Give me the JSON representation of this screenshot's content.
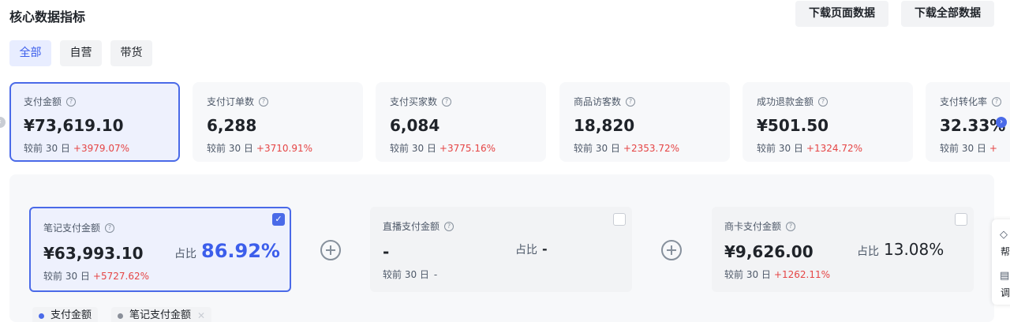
{
  "header": {
    "title": "核心数据指标",
    "download_page": "下载页面数据",
    "download_all": "下载全部数据"
  },
  "tabs": [
    {
      "label": "全部",
      "active": true
    },
    {
      "label": "自营",
      "active": false
    },
    {
      "label": "带货",
      "active": false
    }
  ],
  "metrics": [
    {
      "label": "支付金额",
      "value": "¥73,619.10",
      "compare": "较前 30 日",
      "change": "+3979.07%"
    },
    {
      "label": "支付订单数",
      "value": "6,288",
      "compare": "较前 30 日",
      "change": "+3710.91%"
    },
    {
      "label": "支付买家数",
      "value": "6,084",
      "compare": "较前 30 日",
      "change": "+3775.16%"
    },
    {
      "label": "商品访客数",
      "value": "18,820",
      "compare": "较前 30 日",
      "change": "+2353.72%"
    },
    {
      "label": "成功退款金额",
      "value": "¥501.50",
      "compare": "较前 30 日",
      "change": "+1324.72%"
    },
    {
      "label": "支付转化率",
      "value": "32.33%",
      "compare": "较前 30 日",
      "change": "+"
    }
  ],
  "breakdown": [
    {
      "label": "笔记支付金额",
      "value": "¥63,993.10",
      "ratio_label": "占比",
      "ratio": "86.92%",
      "compare": "较前 30 日",
      "change": "+5727.62%",
      "checked": true
    },
    {
      "label": "直播支付金额",
      "value": "-",
      "ratio_label": "占比",
      "ratio": "-",
      "compare": "较前 30 日",
      "change": "-",
      "checked": false
    },
    {
      "label": "商卡支付金额",
      "value": "¥9,626.00",
      "ratio_label": "占比",
      "ratio": "13.08%",
      "compare": "较前 30 日",
      "change": "+1262.11%",
      "checked": false
    }
  ],
  "legend": [
    {
      "label": "支付金额",
      "color": "#4a6ae8"
    },
    {
      "label": "笔记支付金额",
      "color": "#8a8f99"
    }
  ],
  "float_tools": {
    "help": "帮",
    "adjust": "调"
  },
  "colors": {
    "accent": "#4a6ae8",
    "up": "#e54545"
  }
}
